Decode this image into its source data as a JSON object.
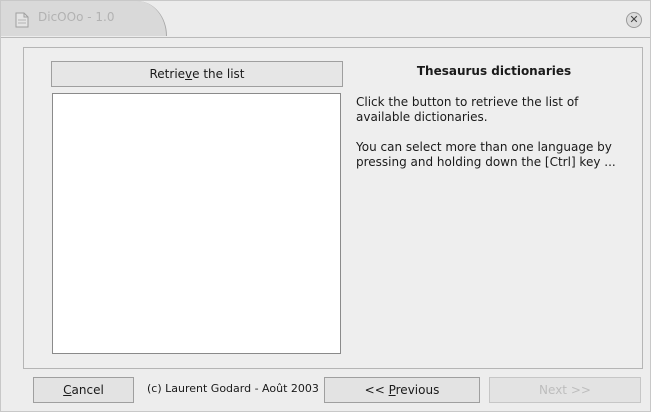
{
  "window": {
    "title": "DicOOo - 1.0",
    "close_glyph": "✕"
  },
  "list_panel": {
    "retrieve_button": {
      "before": "Retrie",
      "accel": "v",
      "after": "e the list"
    }
  },
  "info_panel": {
    "title": "Thesaurus dictionaries",
    "paragraph1": "Click the button to retrieve the list of available dictionaries.",
    "paragraph2": "You can select more than one language by pressing and holding down  the [Ctrl] key ..."
  },
  "footer": {
    "cancel_button": {
      "accel": "C",
      "after": "ancel"
    },
    "copyright": "(c) Laurent Godard - Août 2003",
    "previous_button": {
      "before": "<< ",
      "accel": "P",
      "after": "revious"
    },
    "next_button": "Next >>"
  },
  "icons": {
    "app": "document-icon",
    "close": "close-icon"
  }
}
